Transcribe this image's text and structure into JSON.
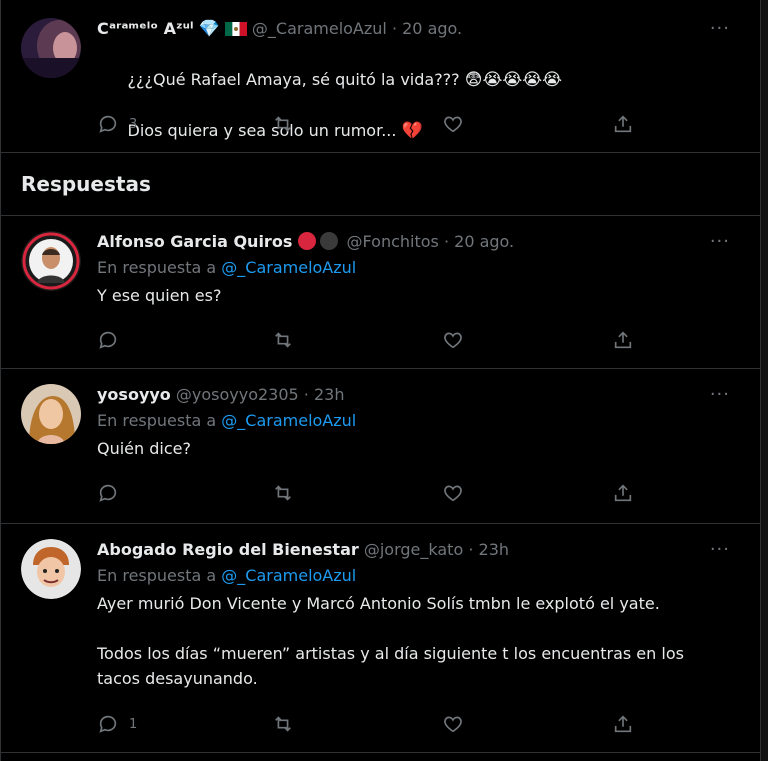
{
  "main_tweet": {
    "display_name": "Cᵃʳᵃᵐᵉˡᵒ Aᶻᵘˡ",
    "handle": "@_CarameloAzul",
    "time": "20 ago.",
    "text_line1": "¿¿¿Qué Rafael Amaya, sé quitó la vida??? ",
    "emojis_line1": "😨😭😭😭😭",
    "text_line2": "Dios quiera y sea solo un rumor... ",
    "emoji_line2": "💔",
    "name_emoji": "💎",
    "reply_count": "3"
  },
  "section_title": "Respuestas",
  "replies": [
    {
      "display_name": "Alfonso Garcia Quiros",
      "handle": "@Fonchitos",
      "time": "20 ago.",
      "reply_prefix": "En respuesta a ",
      "reply_to": "@_CarameloAzul",
      "text": "Y ese quien es?",
      "reply_count": ""
    },
    {
      "display_name": "yosoyyo",
      "handle": "@yosoyyo2305",
      "time": "23h",
      "reply_prefix": "En respuesta a ",
      "reply_to": "@_CarameloAzul",
      "text": "Quién dice?",
      "reply_count": ""
    },
    {
      "display_name": "Abogado Regio del Bienestar",
      "handle": "@jorge_kato",
      "time": "23h",
      "reply_prefix": "En respuesta a ",
      "reply_to": "@_CarameloAzul",
      "text": "Ayer murió Don Vicente y Marcó Antonio Solís tmbn le explotó el yate.\n\nTodos los días “mueren” artistas y al día siguiente t los encuentras en los\ntacos desayunando.",
      "reply_count": "1"
    }
  ],
  "separator": " · ",
  "more_glyph": "···",
  "colors": {
    "background": "#000000",
    "text": "#e7e9ea",
    "muted": "#71767b",
    "link": "#1d9bf0",
    "border": "#2f3336"
  }
}
